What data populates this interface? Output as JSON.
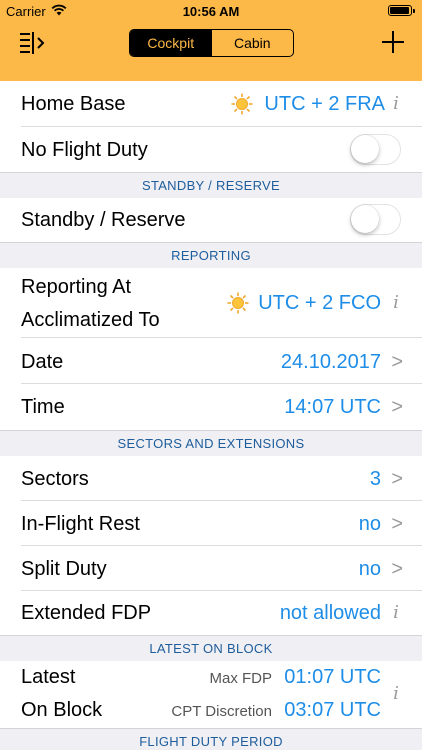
{
  "status_bar": {
    "carrier": "Carrier",
    "time": "10:56 AM"
  },
  "nav": {
    "segments": [
      {
        "label": "Cockpit",
        "selected": true
      },
      {
        "label": "Cabin",
        "selected": false
      }
    ]
  },
  "home_base": {
    "label": "Home Base",
    "value": "UTC + 2 FRA",
    "icon": "sun-icon"
  },
  "no_flight_duty": {
    "label": "No Flight Duty",
    "on": false
  },
  "sections": {
    "standby": "STANDBY / RESERVE",
    "reporting": "REPORTING",
    "sectors": "SECTORS AND EXTENSIONS",
    "latest_on_block": "LATEST ON BLOCK",
    "fdp": "FLIGHT DUTY PERIOD"
  },
  "standby": {
    "label": "Standby / Reserve",
    "on": false
  },
  "reporting": {
    "label_line1": "Reporting At",
    "label_line2": "Acclimatized To",
    "value": "UTC + 2 FCO",
    "date_label": "Date",
    "date_value": "24.10.2017",
    "time_label": "Time",
    "time_value": "14:07 UTC"
  },
  "sectors": {
    "sectors_label": "Sectors",
    "sectors_value": "3",
    "rest_label": "In-Flight Rest",
    "rest_value": "no",
    "split_label": "Split Duty",
    "split_value": "no",
    "ext_label": "Extended FDP",
    "ext_value": "not allowed"
  },
  "latest_on_block": {
    "label_line1": "Latest",
    "label_line2": "On Block",
    "max_fdp_label": "Max FDP",
    "max_fdp_value": "01:07 UTC",
    "cpt_label": "CPT Discretion",
    "cpt_value": "03:07 UTC"
  },
  "colors": {
    "accent": "#fdb947",
    "value_blue": "#1e8de8",
    "section_text": "#1e5d9c"
  }
}
